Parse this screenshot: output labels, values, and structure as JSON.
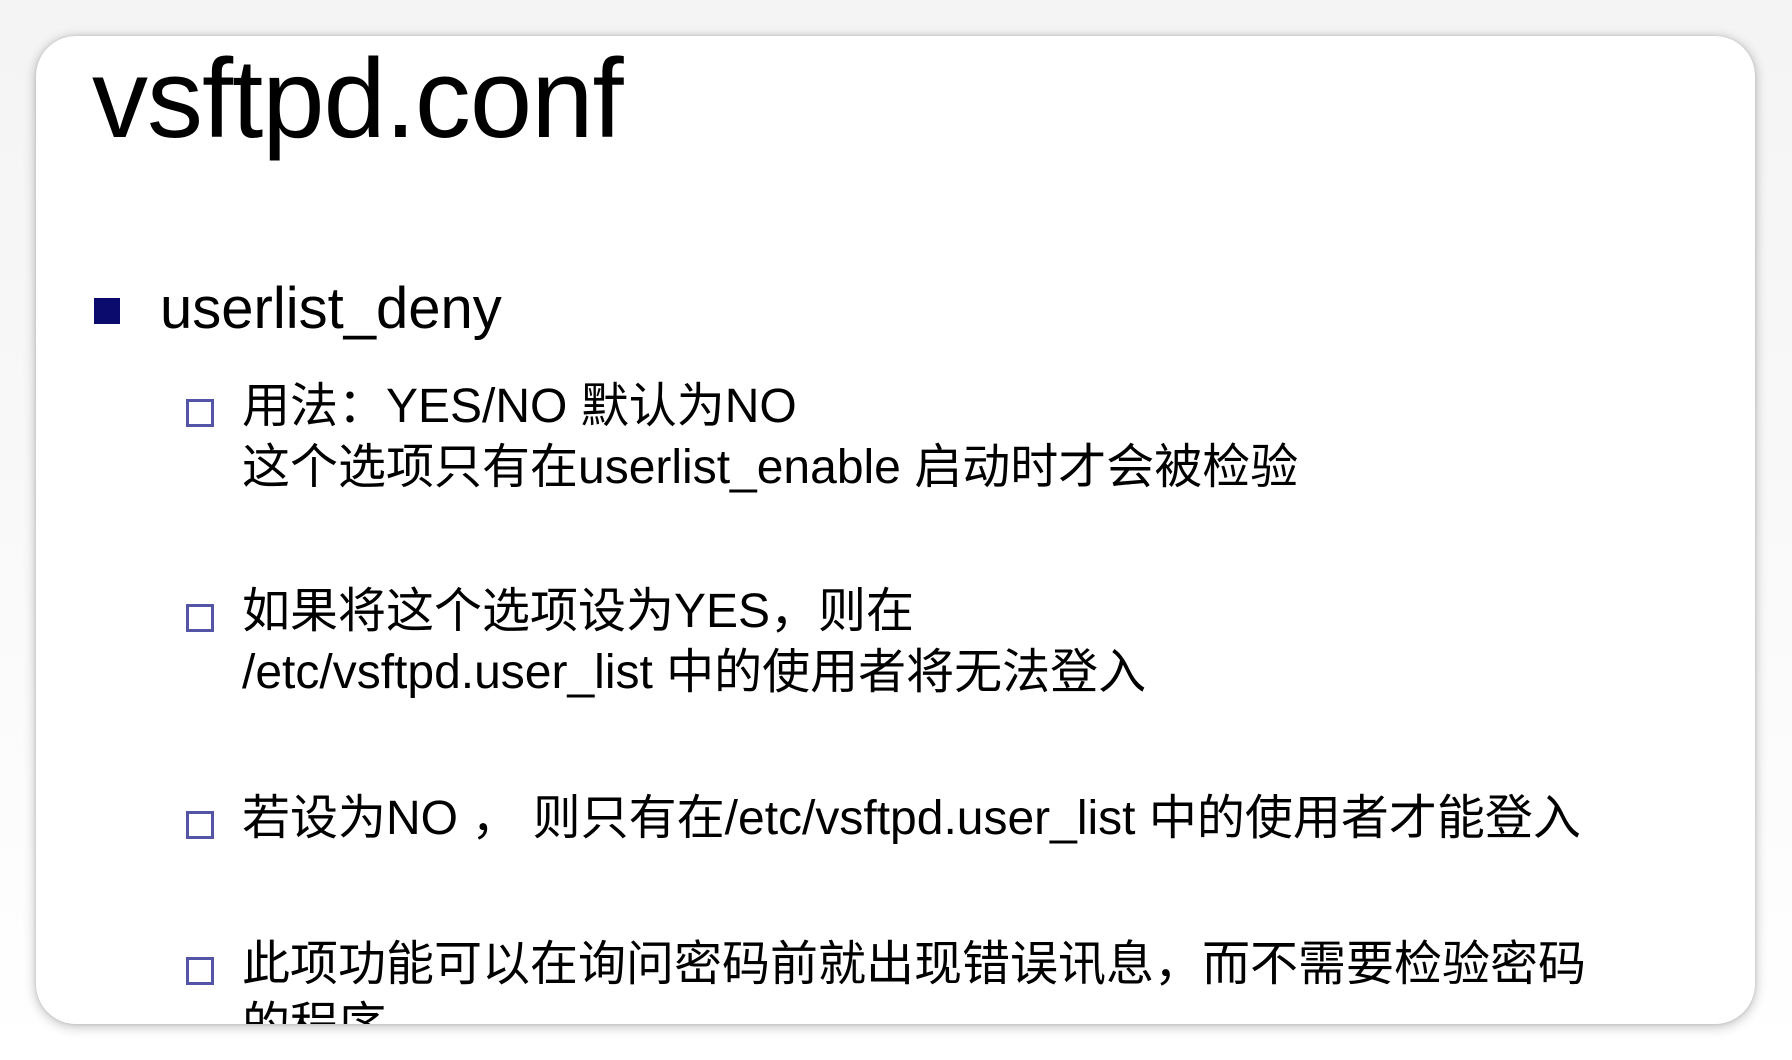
{
  "slide": {
    "title": "vsftpd.conf",
    "bullet": {
      "label": "userlist_deny",
      "items": [
        "用法：YES/NO  默认为NO\n这个选项只有在userlist_enable 启动时才会被检验",
        "如果将这个选项设为YES，则在\n/etc/vsftpd.user_list 中的使用者将无法登入",
        " 若设为NO ， 则只有在/etc/vsftpd.user_list 中的使用者才能登入",
        "此项功能可以在询问密码前就出现错误讯息，而不需要检验密码\n的程序"
      ]
    }
  },
  "colors": {
    "bullet_filled": "#0b0b6e",
    "bullet_hollow": "#5555a8",
    "text": "#000000"
  },
  "icons": {
    "level1_bullet": "filled-square-bullet-icon",
    "level2_bullet": "hollow-square-bullet-icon"
  }
}
